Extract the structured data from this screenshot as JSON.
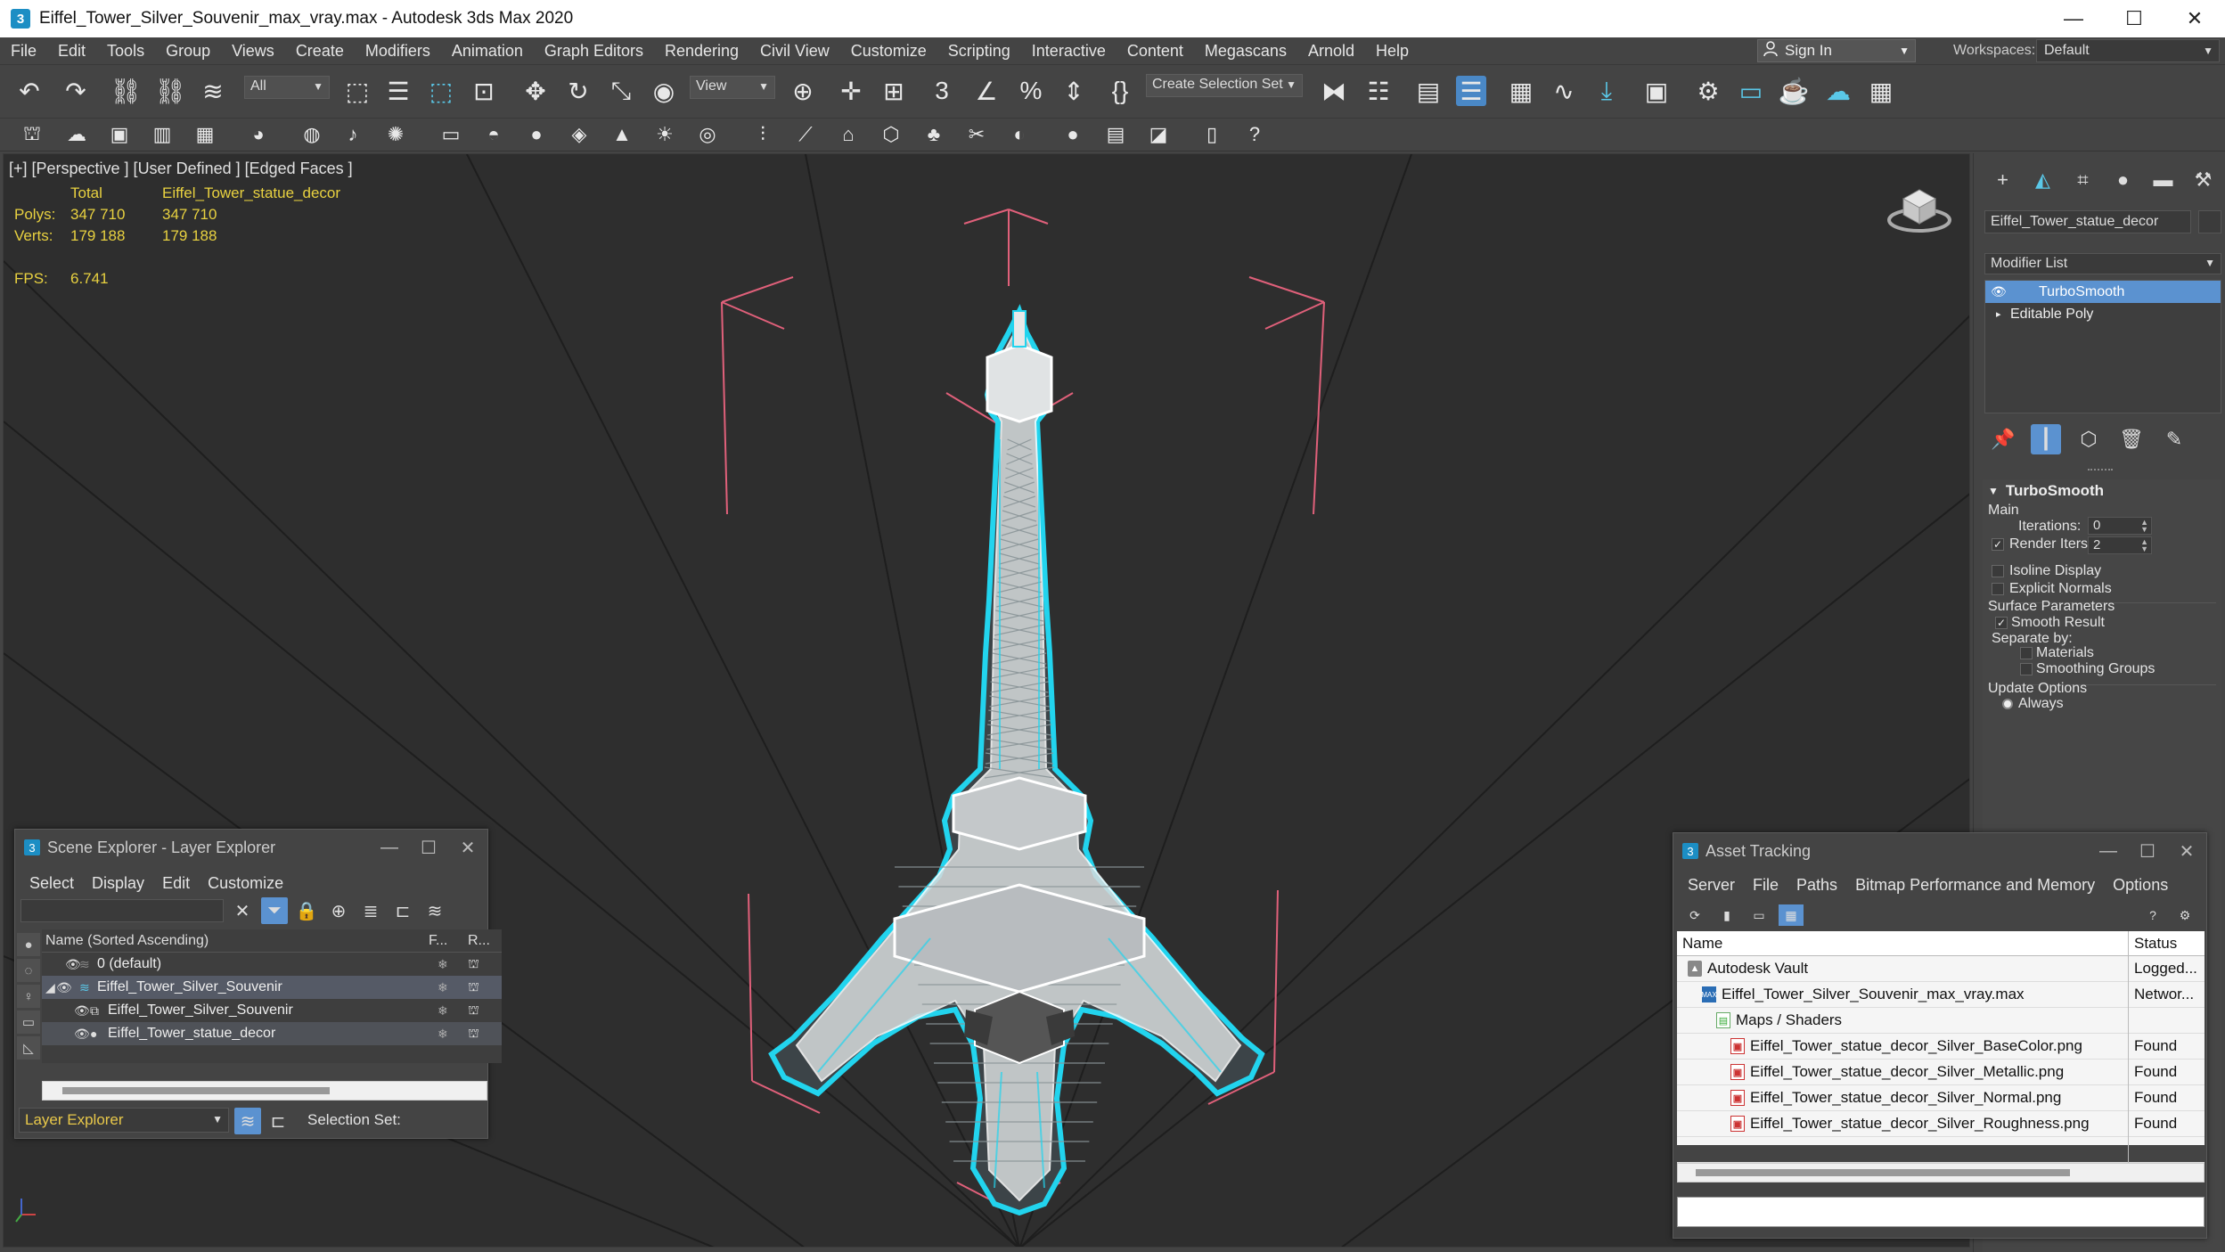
{
  "window": {
    "title": "Eiffel_Tower_Silver_Souvenir_max_vray.max - Autodesk 3ds Max 2020",
    "app_icon_glyph": "3",
    "minimize": "—",
    "maximize": "☐",
    "close": "✕"
  },
  "menubar": {
    "items": [
      "File",
      "Edit",
      "Tools",
      "Group",
      "Views",
      "Create",
      "Modifiers",
      "Animation",
      "Graph Editors",
      "Rendering",
      "Civil View",
      "Customize",
      "Scripting",
      "Interactive",
      "Content",
      "Megascans",
      "Arnold",
      "Help"
    ],
    "sign_in": "Sign In",
    "workspaces_label": "Workspaces:",
    "workspaces_value": "Default"
  },
  "toolbar": {
    "selection_filter": "All",
    "ref_coord": "View",
    "selection_set": "Create Selection Set"
  },
  "viewport": {
    "label": "[+] [Perspective ] [User Defined ] [Edged Faces ]",
    "stats_header_total": "Total",
    "stats_header_object": "Eiffel_Tower_statue_decor",
    "polys_label": "Polys:",
    "polys_total": "347 710",
    "polys_object": "347 710",
    "verts_label": "Verts:",
    "verts_total": "179 188",
    "verts_object": "179 188",
    "fps_label": "FPS:",
    "fps_value": "6.741",
    "colors": {
      "background": "#2e2e2e",
      "wire": "#ffffff",
      "selection_outline": "#22d4ee",
      "bbox": "#e0607a",
      "grid": "#1e1e1e"
    }
  },
  "command_panel": {
    "tabs": [
      "create-icon",
      "modify-icon",
      "hierarchy-icon",
      "motion-icon",
      "display-icon",
      "utilities-icon"
    ],
    "object_name": "Eiffel_Tower_statue_decor",
    "modifier_list": "Modifier List",
    "stack": [
      {
        "label": "TurboSmooth",
        "selected": true
      },
      {
        "label": "Editable Poly",
        "selected": false
      }
    ],
    "turbosmooth": {
      "title": "TurboSmooth",
      "main": "Main",
      "iterations_label": "Iterations:",
      "iterations_value": "0",
      "render_iters_label": "Render Iters:",
      "render_iters_value": "2",
      "render_iters_checked": true,
      "isoline": "Isoline Display",
      "explicit_normals": "Explicit Normals",
      "surface_params": "Surface Parameters",
      "smooth_result": "Smooth Result",
      "separate_by": "Separate by:",
      "materials": "Materials",
      "smoothing_groups": "Smoothing Groups",
      "update_options": "Update Options",
      "always": "Always"
    }
  },
  "scene_explorer": {
    "title": "Scene Explorer - Layer Explorer",
    "menu": [
      "Select",
      "Display",
      "Edit",
      "Customize"
    ],
    "col_name": "Name (Sorted Ascending)",
    "col_f": "F...",
    "col_r": "R...",
    "rows": [
      {
        "label": "0 (default)",
        "indent": 1
      },
      {
        "label": "Eiffel_Tower_Silver_Souvenir",
        "indent": 1
      },
      {
        "label": "Eiffel_Tower_Silver_Souvenir",
        "indent": 2
      },
      {
        "label": "Eiffel_Tower_statue_decor",
        "indent": 2
      }
    ],
    "footer_mode": "Layer Explorer",
    "selection_set_label": "Selection Set:"
  },
  "asset_tracking": {
    "title": "Asset Tracking",
    "menu": [
      "Server",
      "File",
      "Paths",
      "Bitmap Performance and Memory",
      "Options"
    ],
    "col_name": "Name",
    "col_status": "Status",
    "rows": [
      {
        "name": "Autodesk Vault",
        "status": "Logged...",
        "indent": 0,
        "icon": "vault"
      },
      {
        "name": "Eiffel_Tower_Silver_Souvenir_max_vray.max",
        "status": "Networ...",
        "indent": 1,
        "icon": "max"
      },
      {
        "name": "Maps / Shaders",
        "status": "",
        "indent": 2,
        "icon": "folder"
      },
      {
        "name": "Eiffel_Tower_statue_decor_Silver_BaseColor.png",
        "status": "Found",
        "indent": 3,
        "icon": "png"
      },
      {
        "name": "Eiffel_Tower_statue_decor_Silver_Metallic.png",
        "status": "Found",
        "indent": 3,
        "icon": "png"
      },
      {
        "name": "Eiffel_Tower_statue_decor_Silver_Normal.png",
        "status": "Found",
        "indent": 3,
        "icon": "png"
      },
      {
        "name": "Eiffel_Tower_statue_decor_Silver_Roughness.png",
        "status": "Found",
        "indent": 3,
        "icon": "png"
      }
    ]
  }
}
